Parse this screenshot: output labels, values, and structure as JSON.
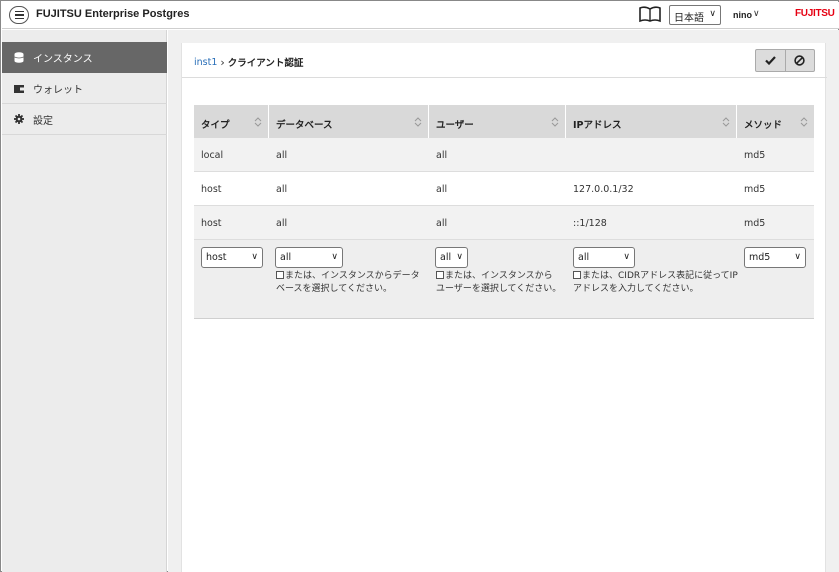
{
  "header": {
    "app_title": "FUJITSU Enterprise Postgres",
    "language": "日本語",
    "user": "nino",
    "logo": "FUJITSU"
  },
  "sidebar": {
    "items": [
      {
        "label": "インスタンス",
        "icon": "database-icon",
        "active": true
      },
      {
        "label": "ウォレット",
        "icon": "wallet-icon",
        "active": false
      },
      {
        "label": "設定",
        "icon": "gear-icon",
        "active": false
      }
    ]
  },
  "breadcrumb": {
    "parent": "inst1",
    "current": "クライアント認証"
  },
  "table": {
    "headers": [
      "タイプ",
      "データベース",
      "ユーザー",
      "IPアドレス",
      "メソッド"
    ],
    "rows": [
      [
        "local",
        "all",
        "all",
        "",
        "md5"
      ],
      [
        "host",
        "all",
        "all",
        "127.0.0.1/32",
        "md5"
      ],
      [
        "host",
        "all",
        "all",
        "::1/128",
        "md5"
      ]
    ],
    "edit_row": {
      "type": "host",
      "database": "all",
      "user": "all",
      "ip": "all",
      "method": "md5",
      "database_hint_1": "または、インスタンスからデータ",
      "database_hint_2": "ベースを選択してください。",
      "user_hint_1": "または、インスタンスから",
      "user_hint_2": "ユーザーを選択してください。",
      "ip_hint_1": "または、CIDRアドレス表記に従ってIP",
      "ip_hint_2": "アドレスを入力してください。"
    }
  },
  "colors": {
    "sidebar_active": "#676767",
    "link": "#2a6fb8",
    "logo_red": "#e60012"
  }
}
